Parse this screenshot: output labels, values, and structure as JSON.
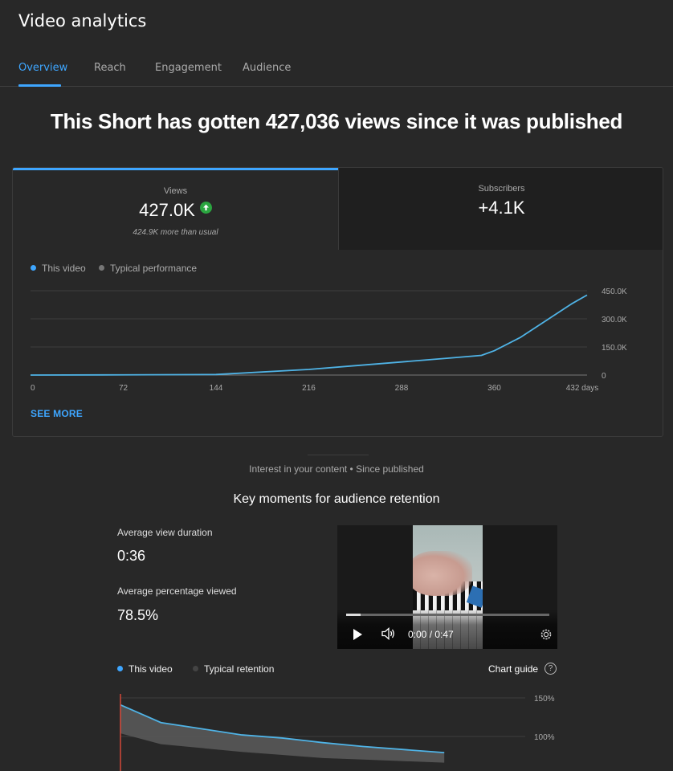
{
  "app": {
    "title": "Video analytics"
  },
  "tabs": [
    {
      "label": "Overview",
      "active": true
    },
    {
      "label": "Reach",
      "active": false
    },
    {
      "label": "Engagement",
      "active": false
    },
    {
      "label": "Audience",
      "active": false
    }
  ],
  "headline": "This Short has gotten 427,036 views since it was published",
  "metrics": {
    "views": {
      "label": "Views",
      "value": "427.0K",
      "note": "424.9K more than usual",
      "trend_icon": "arrow-up-circle-icon"
    },
    "subscribers": {
      "label": "Subscribers",
      "value": "+4.1K"
    }
  },
  "views_chart": {
    "legend": {
      "this_video": "This video",
      "typical": "Typical performance"
    },
    "see_more": "SEE MORE"
  },
  "retention": {
    "subtitle": "Interest in your content • Since published",
    "title": "Key moments for audience retention",
    "avg_duration_label": "Average view duration",
    "avg_duration_value": "0:36",
    "avg_pct_label": "Average percentage viewed",
    "avg_pct_value": "78.5%",
    "legend": {
      "this_video": "This video",
      "typical": "Typical retention"
    },
    "chart_guide": "Chart guide",
    "help_icon": "?"
  },
  "player": {
    "time": "0:00 / 0:47",
    "progress": 0.07
  },
  "colors": {
    "accent": "#3ea6ff",
    "line": "#4fb3e6",
    "positive": "#2ba640",
    "background": "#282828"
  },
  "chart_data": [
    {
      "type": "line",
      "series": [
        {
          "name": "This video",
          "x": [
            0,
            72,
            144,
            216,
            252,
            288,
            324,
            350,
            360,
            380,
            400,
            420,
            432
          ],
          "values": [
            0,
            1000,
            3000,
            30000,
            50000,
            70000,
            90000,
            105000,
            130000,
            200000,
            290000,
            380000,
            427000
          ]
        }
      ],
      "xticks": [
        "0",
        "72",
        "144",
        "216",
        "288",
        "360",
        "432 days"
      ],
      "yticks": [
        "0",
        "150.0K",
        "300.0K",
        "450.0K"
      ],
      "xlim": [
        0,
        432
      ],
      "ylim": [
        0,
        450000
      ]
    },
    {
      "type": "area",
      "series": [
        {
          "name": "This video",
          "x": [
            0,
            0.1,
            0.2,
            0.3,
            0.4,
            0.5,
            0.6,
            0.7,
            0.8
          ],
          "values": [
            141,
            118,
            110,
            102,
            98,
            92,
            87,
            83,
            79
          ]
        },
        {
          "name": "Typical retention",
          "x": [
            0,
            0.1,
            0.2,
            0.3,
            0.4,
            0.5,
            0.6,
            0.7,
            0.8
          ],
          "values": [
            104,
            90,
            85,
            80,
            76,
            72,
            70,
            68,
            66
          ]
        }
      ],
      "yticks": [
        "100%",
        "150%"
      ],
      "ylim": [
        40,
        150
      ]
    }
  ]
}
